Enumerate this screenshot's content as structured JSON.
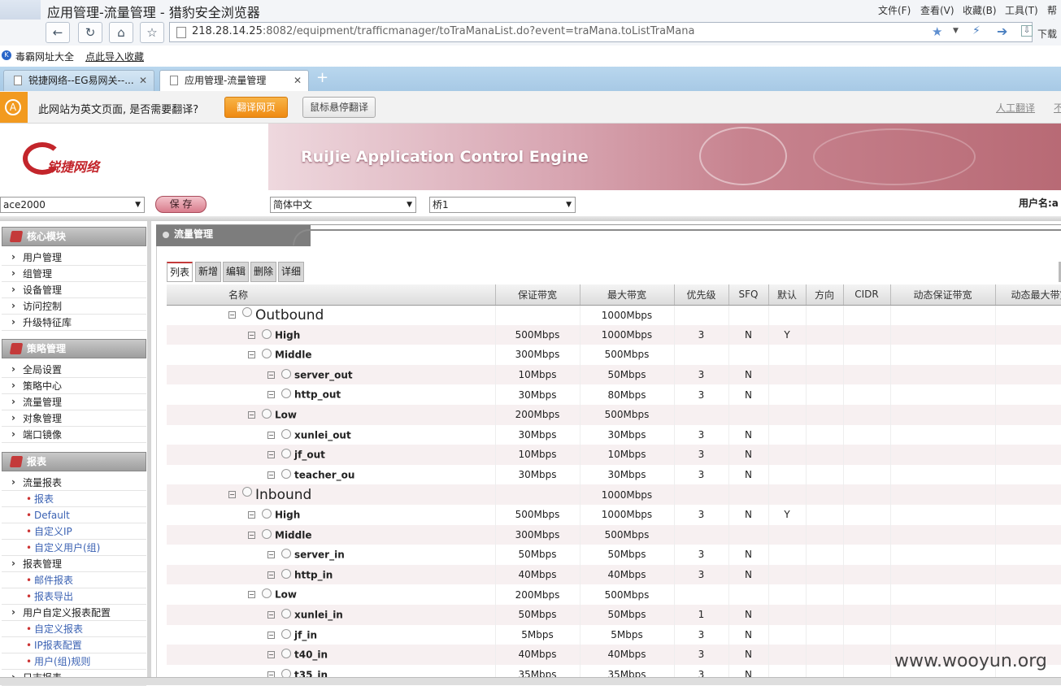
{
  "browser": {
    "window_title": "应用管理-流量管理 - 猎豹安全浏览器",
    "menus": [
      "文件(F)",
      "查看(V)",
      "收藏(B)",
      "工具(T)",
      "帮助"
    ],
    "url_host": "218.28.14.25",
    "url_rest": ":8082/equipment/trafficmanager/toTraManaList.do?event=traMana.toListTraMana",
    "download_label": "下载",
    "bookmarks": [
      "毒霸网址大全",
      "点此导入收藏"
    ],
    "tabs": [
      {
        "label": "锐捷网络--EG易网关--..."
      },
      {
        "label": "应用管理-流量管理"
      }
    ],
    "new_tab": "+",
    "translate": {
      "prompt": "此网站为英文页面, 是否需要翻译?",
      "translate_btn": "翻译网页",
      "hover_btn": "鼠标悬停翻译",
      "human": "人工翻译",
      "no": "不"
    }
  },
  "banner": {
    "brand": "锐捷网络",
    "product": "RuiJie Application Control Engine"
  },
  "toolbar": {
    "device": "ace2000",
    "save": "保 存",
    "language": "简体中文",
    "bridge": "桥1",
    "user_label": "用户名:a"
  },
  "sidebar": {
    "sections": [
      {
        "title": "核心模块",
        "items": [
          "用户管理",
          "组管理",
          "设备管理",
          "访问控制",
          "升级特征库"
        ]
      },
      {
        "title": "策略管理",
        "items": [
          "全局设置",
          "策略中心",
          "流量管理",
          "对象管理",
          "端口镜像"
        ]
      },
      {
        "title": "报表"
      }
    ],
    "report_items": [
      {
        "label": "流量报表",
        "level": 1
      },
      {
        "label": "报表",
        "level": 2
      },
      {
        "label": "Default",
        "level": 2
      },
      {
        "label": "自定义IP",
        "level": 2
      },
      {
        "label": "自定义用户(组)",
        "level": 2
      },
      {
        "label": "报表管理",
        "level": 1
      },
      {
        "label": "邮件报表",
        "level": 2
      },
      {
        "label": "报表导出",
        "level": 2
      },
      {
        "label": "用户自定义报表配置",
        "level": 1
      },
      {
        "label": "自定义报表",
        "level": 2
      },
      {
        "label": "IP报表配置",
        "level": 2
      },
      {
        "label": "用户(组)规则",
        "level": 2
      },
      {
        "label": "日志报表",
        "level": 1
      }
    ]
  },
  "content": {
    "breadcrumb": "流量管理",
    "actions": [
      "列表",
      "新增",
      "编辑",
      "删除",
      "详细"
    ],
    "columns": [
      "名称",
      "保证带宽",
      "最大带宽",
      "优先级",
      "SFQ",
      "默认",
      "方向",
      "CIDR",
      "动态保证带宽",
      "动态最大带宽"
    ],
    "rows": [
      {
        "indent": 0,
        "name": "Outbound",
        "guar": "",
        "max": "1000Mbps",
        "prio": "",
        "sfq": "",
        "def": ""
      },
      {
        "indent": 1,
        "name": "High",
        "guar": "500Mbps",
        "max": "1000Mbps",
        "prio": "3",
        "sfq": "N",
        "def": "Y"
      },
      {
        "indent": 1,
        "name": "Middle",
        "guar": "300Mbps",
        "max": "500Mbps",
        "prio": "",
        "sfq": "",
        "def": ""
      },
      {
        "indent": 2,
        "name": "server_out",
        "guar": "10Mbps",
        "max": "50Mbps",
        "prio": "3",
        "sfq": "N",
        "def": ""
      },
      {
        "indent": 2,
        "name": "http_out",
        "guar": "30Mbps",
        "max": "80Mbps",
        "prio": "3",
        "sfq": "N",
        "def": ""
      },
      {
        "indent": 1,
        "name": "Low",
        "guar": "200Mbps",
        "max": "500Mbps",
        "prio": "",
        "sfq": "",
        "def": ""
      },
      {
        "indent": 2,
        "name": "xunlei_out",
        "guar": "30Mbps",
        "max": "30Mbps",
        "prio": "3",
        "sfq": "N",
        "def": ""
      },
      {
        "indent": 2,
        "name": "jf_out",
        "guar": "10Mbps",
        "max": "10Mbps",
        "prio": "3",
        "sfq": "N",
        "def": ""
      },
      {
        "indent": 2,
        "name": "teacher_ou",
        "guar": "30Mbps",
        "max": "30Mbps",
        "prio": "3",
        "sfq": "N",
        "def": ""
      },
      {
        "indent": 0,
        "name": "Inbound",
        "guar": "",
        "max": "1000Mbps",
        "prio": "",
        "sfq": "",
        "def": ""
      },
      {
        "indent": 1,
        "name": "High",
        "guar": "500Mbps",
        "max": "1000Mbps",
        "prio": "3",
        "sfq": "N",
        "def": "Y"
      },
      {
        "indent": 1,
        "name": "Middle",
        "guar": "300Mbps",
        "max": "500Mbps",
        "prio": "",
        "sfq": "",
        "def": ""
      },
      {
        "indent": 2,
        "name": "server_in",
        "guar": "50Mbps",
        "max": "50Mbps",
        "prio": "3",
        "sfq": "N",
        "def": ""
      },
      {
        "indent": 2,
        "name": "http_in",
        "guar": "40Mbps",
        "max": "40Mbps",
        "prio": "3",
        "sfq": "N",
        "def": ""
      },
      {
        "indent": 1,
        "name": "Low",
        "guar": "200Mbps",
        "max": "500Mbps",
        "prio": "",
        "sfq": "",
        "def": ""
      },
      {
        "indent": 2,
        "name": "xunlei_in",
        "guar": "50Mbps",
        "max": "50Mbps",
        "prio": "1",
        "sfq": "N",
        "def": ""
      },
      {
        "indent": 2,
        "name": "jf_in",
        "guar": "5Mbps",
        "max": "5Mbps",
        "prio": "3",
        "sfq": "N",
        "def": ""
      },
      {
        "indent": 2,
        "name": "t40_in",
        "guar": "40Mbps",
        "max": "40Mbps",
        "prio": "3",
        "sfq": "N",
        "def": ""
      },
      {
        "indent": 2,
        "name": "t35_in",
        "guar": "35Mbps",
        "max": "35Mbps",
        "prio": "3",
        "sfq": "N",
        "def": ""
      }
    ]
  },
  "watermark": "www.wooyun.org",
  "colors": {
    "accent": "#c43a3a",
    "banner": "#c7838f",
    "tabbar": "#a7c9e5",
    "translate_btn": "#f29a1f"
  }
}
